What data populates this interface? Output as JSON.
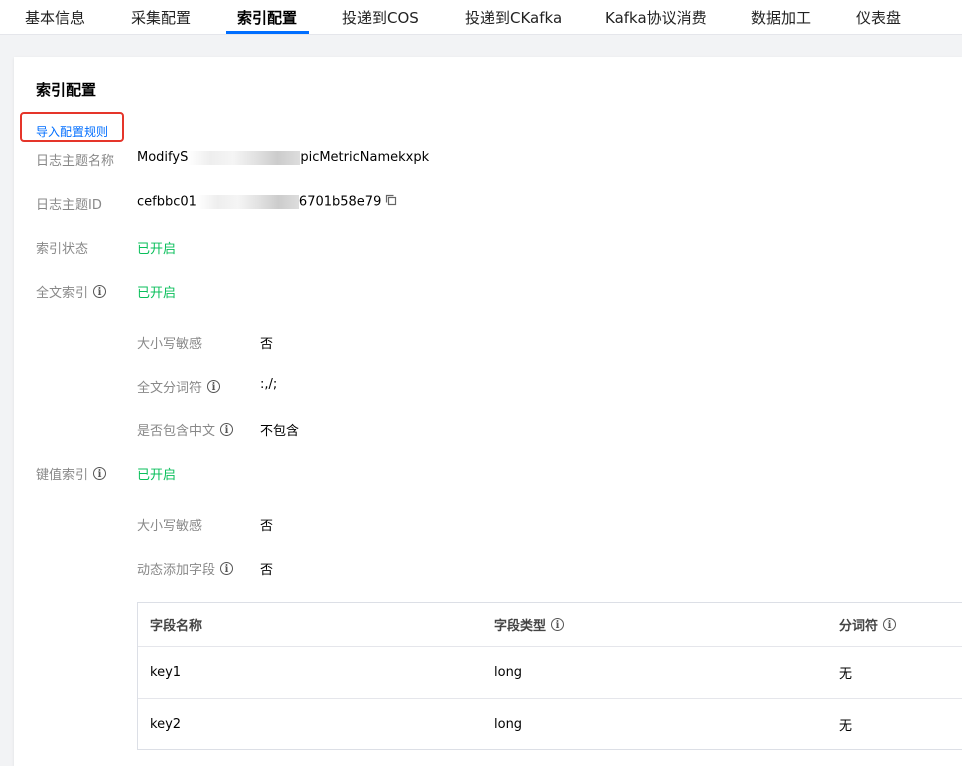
{
  "tabs": [
    "基本信息",
    "采集配置",
    "索引配置",
    "投递到COS",
    "投递到CKafka",
    "Kafka协议消费",
    "数据加工",
    "仪表盘"
  ],
  "active_tab": "索引配置",
  "section_title": "索引配置",
  "import_link": "导入配置规则",
  "topic_name": {
    "label": "日志主题名称",
    "value_prefix": "ModifyS",
    "value_suffix": "picMetricNamekxpk"
  },
  "topic_id": {
    "label": "日志主题ID",
    "value_prefix": "cefbbc01",
    "value_suffix": "6701b58e79"
  },
  "index_status": {
    "label": "索引状态",
    "value": "已开启"
  },
  "full_text": {
    "label": "全文索引",
    "value": "已开启",
    "case_sensitive": {
      "label": "大小写敏感",
      "value": "否"
    },
    "tokenizer": {
      "label": "全文分词符",
      "value": ":,/;"
    },
    "include_chinese": {
      "label": "是否包含中文",
      "value": "不包含"
    }
  },
  "kv_index": {
    "label": "键值索引",
    "value": "已开启",
    "case_sensitive": {
      "label": "大小写敏感",
      "value": "否"
    },
    "dynamic_fields": {
      "label": "动态添加字段",
      "value": "否"
    }
  },
  "field_table": {
    "headers": [
      "字段名称",
      "字段类型",
      "分词符"
    ],
    "rows": [
      [
        "key1",
        "long",
        "无"
      ],
      [
        "key2",
        "long",
        "无"
      ]
    ]
  },
  "colors": {
    "accent": "#006eff",
    "success": "#0abf5b",
    "highlight": "#e5352a"
  }
}
